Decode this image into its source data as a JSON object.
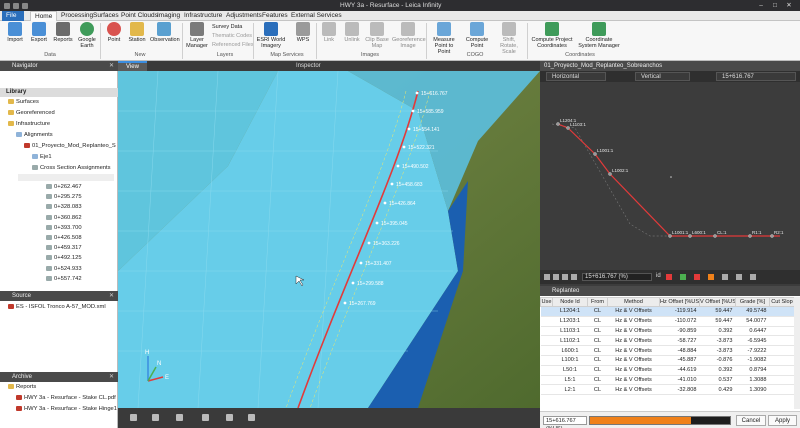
{
  "window": {
    "title": "HWY 3a - Resurface - Leica Infinity",
    "minimize": "–",
    "maximize": "□",
    "close": "✕"
  },
  "menu": {
    "file": "File",
    "tabs": [
      "Home",
      "Processing",
      "Surfaces",
      "Point Clouds",
      "Imaging",
      "Infrastructure",
      "Adjustments",
      "Features",
      "External Services"
    ]
  },
  "ribbon": {
    "import": "Import",
    "export": "Export",
    "reports": "Reports",
    "google_earth": "Google Earth",
    "point": "Point",
    "station": "Station",
    "observation": "Observation",
    "layer_manager": "Layer Manager",
    "survey_data": "Survey Data",
    "thematic_codes": "Thematic Codes",
    "referenced_files": "Referenced Files",
    "esri_imagery": "ESRI World Imagery",
    "wps": "WPS",
    "link": "Link",
    "unlink": "Unlink",
    "clip_base_map": "Clip Base Map",
    "georeference_image": "Georeference Image",
    "measure_point_to_point": "Measure Point to Point",
    "compute_point": "Compute Point",
    "shift_rotate_scale": "Shift, Rotate, Scale",
    "compute_project_coordinates": "Compute Project Coordinates",
    "coordinate_system_manager": "Coordinate System Manager",
    "groups": {
      "data": "Data",
      "new": "New",
      "layers": "Layers",
      "map_services": "Map Services",
      "images": "Images",
      "cogo": "COGO",
      "coordinates": "Coordinates"
    }
  },
  "navigator": {
    "title": "Navigator",
    "library": "Library",
    "items": {
      "surfaces": "Surfaces",
      "georeferenced": "Georeferenced",
      "infrastructure": "Infrastructure",
      "alignments": "Alignments",
      "project": "01_Proyecto_Mod_Replanteo_S",
      "eje": "Eje1",
      "cross_section_assignments": "Cross Section Assignments"
    },
    "stations": [
      "0+262.467",
      "0+295.275",
      "0+328.083",
      "0+360.862",
      "0+393.700",
      "0+426.508",
      "0+459.317",
      "0+492.125",
      "0+524.933",
      "0+557.742"
    ],
    "source_title": "Source",
    "source_file": "ES - ISFOL Tronco A-57_MOD.xml",
    "archive_title": "Archive",
    "reports": "Reports",
    "report_files": [
      "HWY 3a - Resurface - Stake CL.pdf",
      "HWY 3a - Resurface - Stake Hinge1"
    ]
  },
  "view": {
    "tabs": [
      "View",
      "Inspector"
    ],
    "labels": [
      "15+616.767",
      "15+585.959",
      "15+554.141",
      "15+522.321",
      "15+490.502",
      "15+458.683",
      "15+426.864",
      "15+395.045",
      "15+363.226",
      "15+331.407",
      "15+299.588",
      "15+267.769"
    ],
    "axes": {
      "z": "H",
      "y": "N",
      "x": "E"
    }
  },
  "profile": {
    "title": "01_Proyecto_Mod_Replanteo_Sobreanchos",
    "tabs": [
      "Horizontal",
      "Vertical",
      "15+616.767"
    ],
    "labels": [
      "L1204:1",
      "L1103:1",
      "L1001:1",
      "L1002:1",
      "L1001:1",
      "L600:1",
      "CL:1",
      "R1:1",
      "R2:1"
    ],
    "station": "15+616.767 (%)",
    "station_suffix": "id"
  },
  "replanteo": {
    "title": "Replanteo",
    "columns": [
      "Use",
      "Node Id",
      "From",
      "Method",
      "Hz Offset [%US]",
      "V Offset [%US]",
      "Grade [%]",
      "Cut Slop"
    ],
    "rows": [
      [
        "",
        "L1204:1",
        "CL",
        "Hz & V Offsets",
        "-119.914",
        "59.447",
        "49.5748",
        ""
      ],
      [
        "",
        "L1203:1",
        "CL",
        "Hz & V Offsets",
        "-110.072",
        "59.447",
        "54.0077",
        ""
      ],
      [
        "",
        "L1103:1",
        "CL",
        "Hz & V Offsets",
        "-90.859",
        "0.392",
        "0.6447",
        ""
      ],
      [
        "",
        "L1102:1",
        "CL",
        "Hz & V Offsets",
        "-58.727",
        "-3.873",
        "-6.5945",
        ""
      ],
      [
        "",
        "L600:1",
        "CL",
        "Hz & V Offsets",
        "-48.884",
        "-3.873",
        "-7.9222",
        ""
      ],
      [
        "",
        "L100:1",
        "CL",
        "Hz & V Offsets",
        "-45.887",
        "-0.876",
        "-1.9082",
        ""
      ],
      [
        "",
        "L50:1",
        "CL",
        "Hz & V Offsets",
        "-44.619",
        "0.392",
        "0.8794",
        ""
      ],
      [
        "",
        "L5:1",
        "CL",
        "Hz & V Offsets",
        "-41.010",
        "0.537",
        "1.3088",
        ""
      ],
      [
        "",
        "L2:1",
        "CL",
        "Hz & V Offsets",
        "-32.808",
        "0.429",
        "1.3090",
        ""
      ]
    ],
    "footer_station": "15+616.767 (%US)",
    "progress": 0.72,
    "cancel": "Cancel",
    "apply": "Apply"
  },
  "colors": {
    "accent": "#2a6ebb",
    "progress": "#f0811a",
    "surface": "#5ec8e6",
    "alignment": "#e23a3a"
  }
}
